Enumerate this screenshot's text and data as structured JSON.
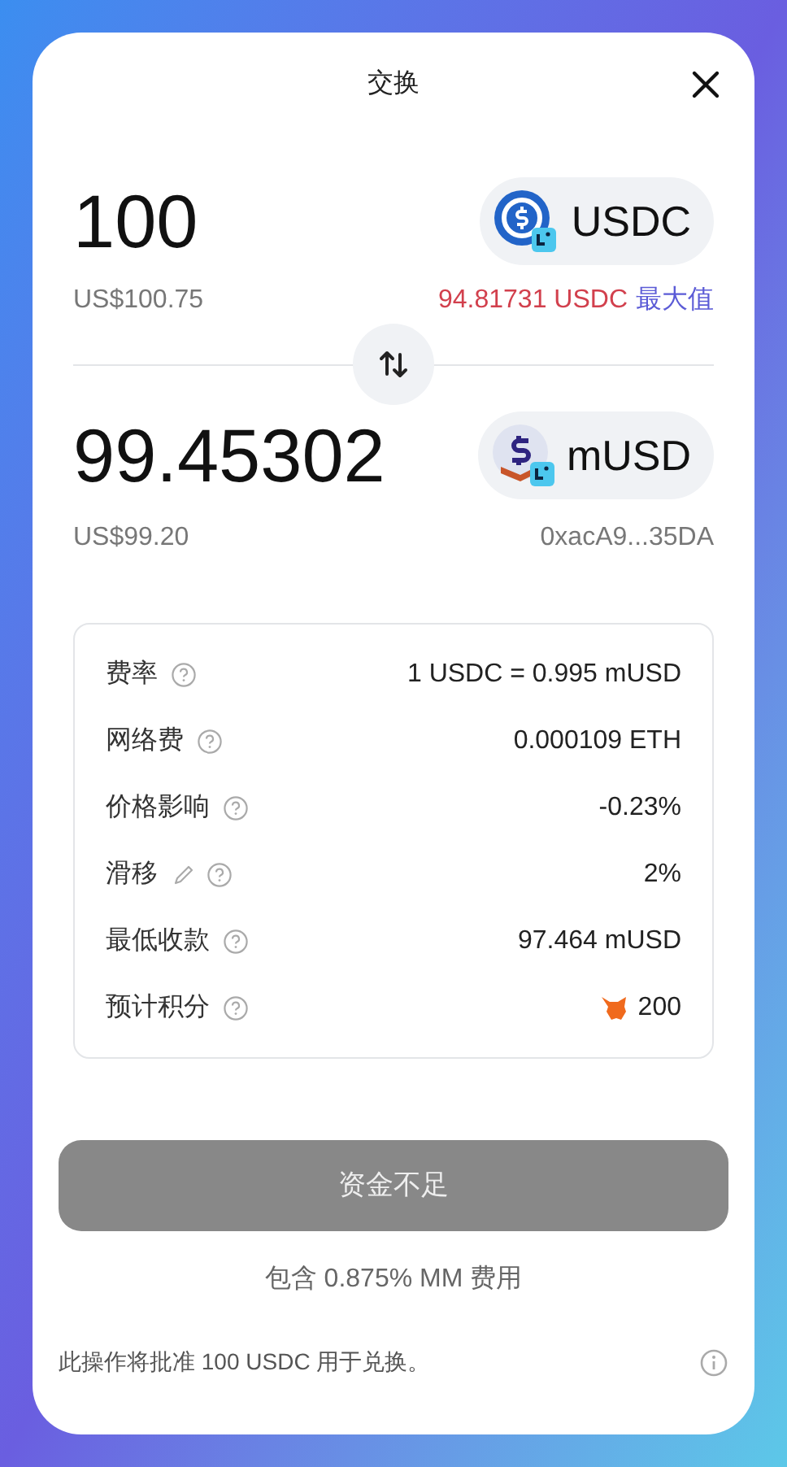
{
  "window": {
    "title": "交换"
  },
  "from": {
    "amount": "100",
    "fiat": "US$100.75",
    "token": "USDC",
    "balance": "94.81731 USDC",
    "insufficient": true,
    "max_label": "最大值"
  },
  "to": {
    "amount": "99.45302",
    "fiat": "US$99.20",
    "token": "mUSD",
    "address": "0xacA9...35DA"
  },
  "details": [
    {
      "label": "费率",
      "value": "1 USDC = 0.995 mUSD",
      "editable": false,
      "kind": "text"
    },
    {
      "label": "网络费",
      "value": "0.000109 ETH",
      "editable": false,
      "kind": "text"
    },
    {
      "label": "价格影响",
      "value": "-0.23%",
      "editable": false,
      "kind": "text"
    },
    {
      "label": "滑移",
      "value": "2%",
      "editable": true,
      "kind": "text"
    },
    {
      "label": "最低收款",
      "value": "97.464 mUSD",
      "editable": false,
      "kind": "text"
    },
    {
      "label": "预计积分",
      "value": "200",
      "editable": false,
      "kind": "points"
    }
  ],
  "submit": {
    "label": "资金不足",
    "disabled": true
  },
  "fee_note": "包含 0.875% MM 费用",
  "footer": "此操作将批准 100 USDC 用于兑换。"
}
